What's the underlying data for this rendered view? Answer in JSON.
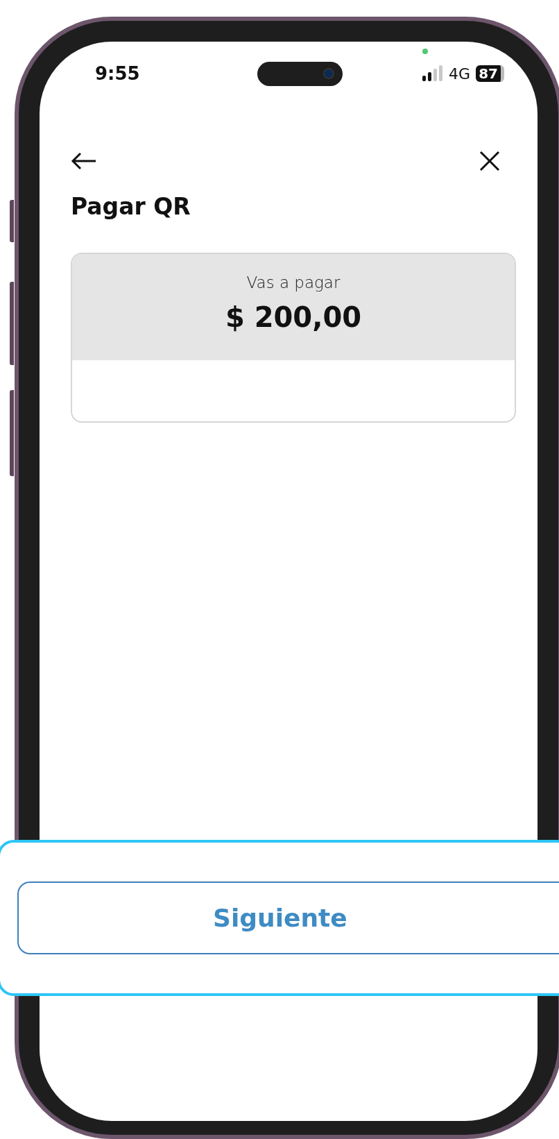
{
  "status_bar": {
    "time": "9:55",
    "network": "4G",
    "battery": "87"
  },
  "header": {
    "title": "Pagar QR"
  },
  "payment_card": {
    "label": "Vas a pagar",
    "amount": "$ 200,00"
  },
  "callout": {
    "button": "Siguiente"
  }
}
